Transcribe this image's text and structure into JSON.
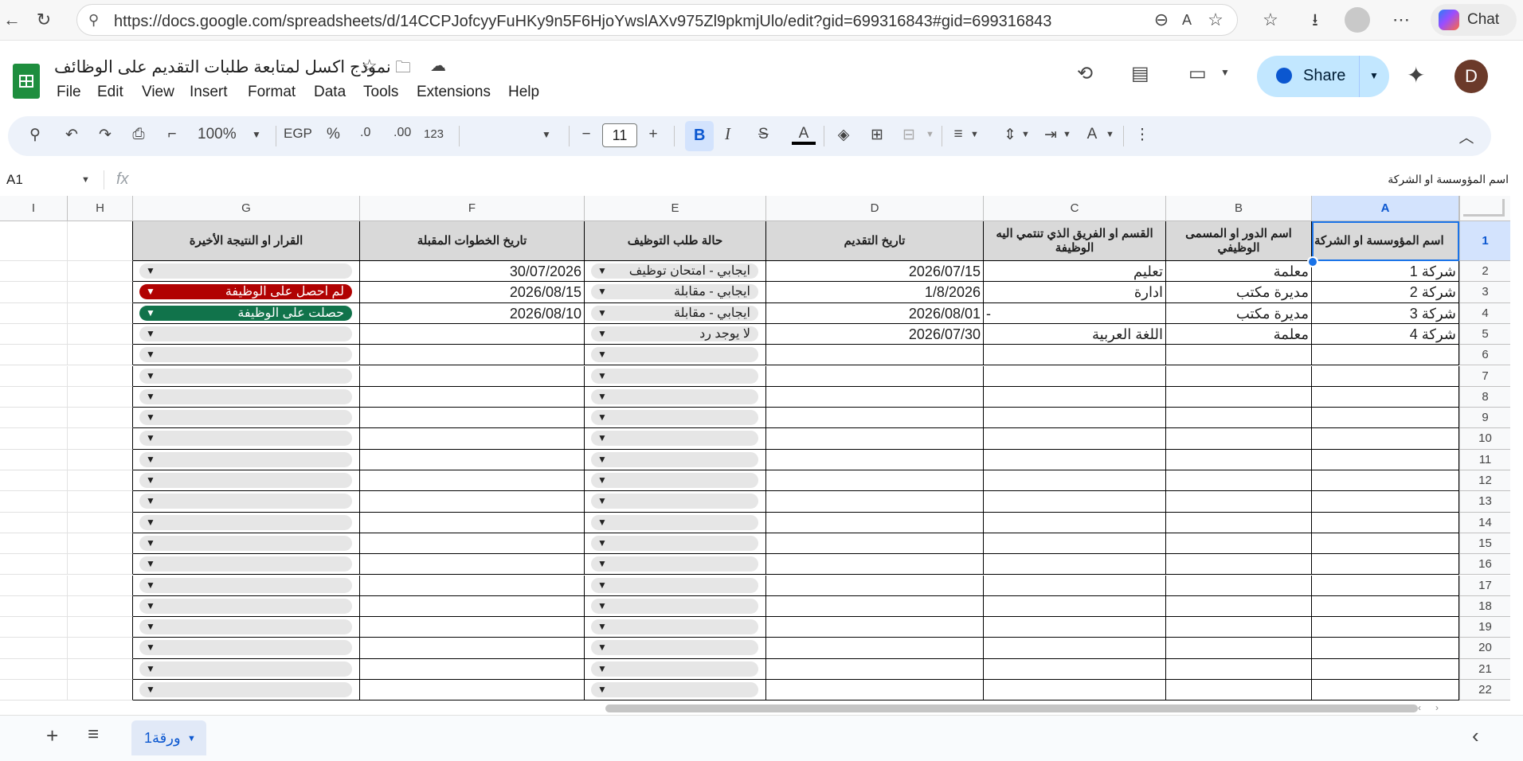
{
  "browser": {
    "url": "https://docs.google.com/spreadsheets/d/14CCPJofcyyFuHKy9n5F6HjoYwslAXv975Zl9pkmjUlo/edit?gid=699316843#gid=699316843",
    "chat_label": "Chat",
    "profile_icon": "person-icon"
  },
  "doc": {
    "title": "نموذج اكسل لمتابعة طلبات التقديم على الوظائف",
    "menus": [
      "File",
      "Edit",
      "View",
      "Insert",
      "Format",
      "Data",
      "Tools",
      "Extensions",
      "Help"
    ],
    "share_label": "Share",
    "avatar_letter": "D"
  },
  "toolbar": {
    "zoom": "100%",
    "currency": "EGP",
    "percent": "%",
    "dec_decrease": ".0",
    "dec_increase": ".00",
    "number_format": "123",
    "font_size": "11",
    "bold": "B",
    "italic": "I",
    "strike": "S",
    "text_color": "A"
  },
  "formula_bar": {
    "name_box": "A1",
    "fx": "fx",
    "content": "اسم المؤوسسة او الشركة"
  },
  "columns": [
    "I",
    "H",
    "G",
    "F",
    "E",
    "D",
    "C",
    "B",
    "A"
  ],
  "header_row": {
    "A": "اسم المؤوسسة او الشركة",
    "B": "اسم الدور او المسمى الوظيفي",
    "C": "القسم او الفريق الذي تنتمي اليه الوظيفة",
    "D": "تاريخ التقديم",
    "E": "حالة طلب التوظيف",
    "F": "تاريخ الخطوات المقبلة",
    "G": "القرار او النتيجة الأخيرة"
  },
  "rows": [
    {
      "A": "شركة 1",
      "B": "معلمة",
      "C": "تعليم",
      "D": "2026/07/15",
      "E": "ايجابي - امتحان توظيف",
      "F": "30/07/2026",
      "G": ""
    },
    {
      "A": "شركة 2",
      "B": "مديرة مكتب",
      "C": "ادارة",
      "D": "1/8/2026",
      "E": "ايجابي - مقابلة",
      "F": "2026/08/15",
      "G": "لم احصل على الوظيفة"
    },
    {
      "A": "شركة 3",
      "B": "مديرة مكتب",
      "C": "-",
      "D": "2026/08/01",
      "E": "ايجابي - مقابلة",
      "F": "2026/08/10",
      "G": "حصلت على الوظيفة"
    },
    {
      "A": "شركة 4",
      "B": "معلمة",
      "C": "اللغة العربية",
      "D": "2026/07/30",
      "E": "لا يوجد رد",
      "F": "",
      "G": ""
    }
  ],
  "row_numbers": [
    "1",
    "2",
    "3",
    "4",
    "5",
    "6",
    "7",
    "8",
    "9",
    "10",
    "11",
    "12",
    "13",
    "14",
    "15",
    "16",
    "17",
    "18",
    "19",
    "20",
    "21",
    "22"
  ],
  "chip_colors": {
    "negative": "#b10202",
    "positive": "#11734b",
    "empty": "#e6e6e6"
  },
  "sheet_tab": "ورقة1"
}
